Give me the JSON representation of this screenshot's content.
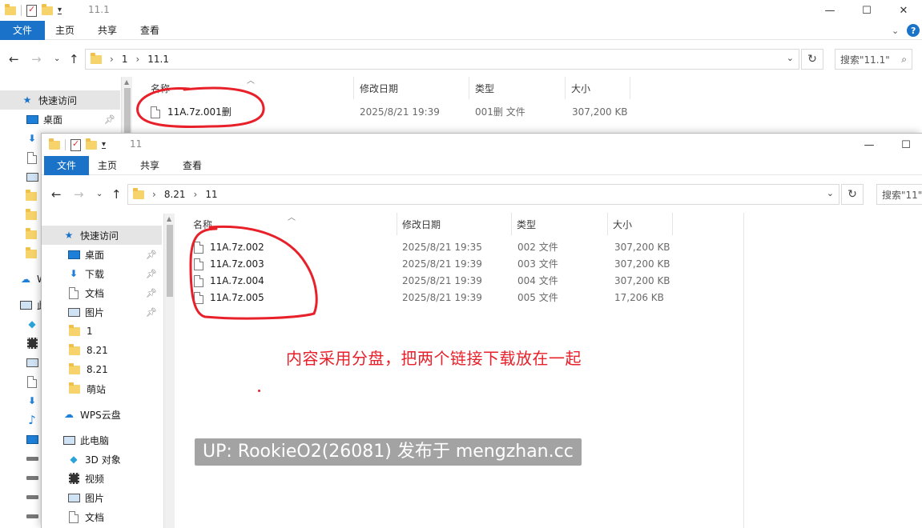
{
  "colors": {
    "accent": "#1a73c9",
    "annotation": "#e8202a",
    "folder": "#f6d36b",
    "selected_nav": "#e5e5e5"
  },
  "back_window": {
    "title": "11.1",
    "ribbon_tabs": [
      "文件",
      "主页",
      "共享",
      "查看"
    ],
    "breadcrumb": [
      "1",
      "11.1"
    ],
    "search_placeholder": "搜索\"11.1\"",
    "columns": {
      "name": "名称",
      "date": "修改日期",
      "type": "类型",
      "size": "大小"
    },
    "files": [
      {
        "name": "11A.7z.001删",
        "date": "2025/8/21 19:39",
        "type": "001删 文件",
        "size": "307,200 KB"
      }
    ],
    "nav": {
      "quick_access": "快速访问",
      "desktop": "桌面",
      "wps_partial": "W",
      "pc_partial": "此"
    },
    "window_controls": {
      "minimize": "—",
      "maximize": "☐",
      "close": "✕"
    }
  },
  "front_window": {
    "title": "11",
    "ribbon_tabs": [
      "文件",
      "主页",
      "共享",
      "查看"
    ],
    "breadcrumb": [
      "8.21",
      "11"
    ],
    "search_placeholder": "搜索\"11\"",
    "columns": {
      "name": "名称",
      "date": "修改日期",
      "type": "类型",
      "size": "大小"
    },
    "files": [
      {
        "name": "11A.7z.002",
        "date": "2025/8/21 19:35",
        "type": "002 文件",
        "size": "307,200 KB"
      },
      {
        "name": "11A.7z.003",
        "date": "2025/8/21 19:39",
        "type": "003 文件",
        "size": "307,200 KB"
      },
      {
        "name": "11A.7z.004",
        "date": "2025/8/21 19:39",
        "type": "004 文件",
        "size": "307,200 KB"
      },
      {
        "name": "11A.7z.005",
        "date": "2025/8/21 19:39",
        "type": "005 文件",
        "size": "17,206 KB"
      }
    ],
    "nav": {
      "quick_access": "快速访问",
      "desktop": "桌面",
      "downloads": "下载",
      "documents": "文档",
      "pictures": "图片",
      "folder_1": "1",
      "folder_821a": "8.21",
      "folder_821b": "8.21",
      "folder_mengzhan": "萌站",
      "wps_cloud": "WPS云盘",
      "this_pc": "此电脑",
      "objects3d": "3D 对象",
      "videos": "视频",
      "pictures2": "图片",
      "documents2": "文档"
    },
    "window_controls": {
      "minimize": "—",
      "maximize": "☐"
    }
  },
  "annotation_text": "内容采用分盘，把两个链接下载放在一起",
  "watermark_text": "UP: RookieO2(26081) 发布于 mengzhan.cc"
}
